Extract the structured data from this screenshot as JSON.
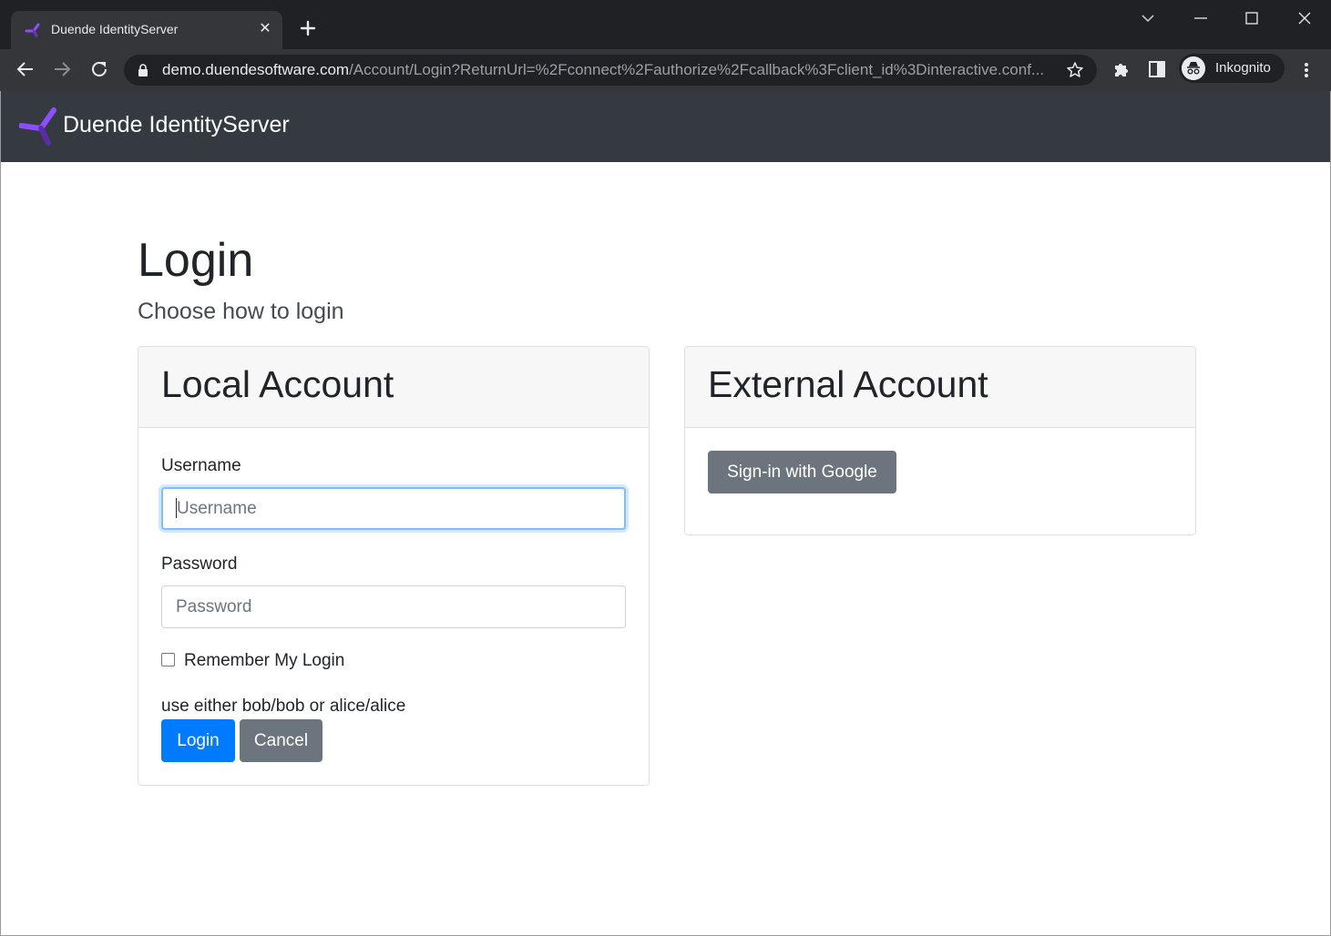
{
  "browser": {
    "tab_title": "Duende IdentityServer",
    "tab_close": "✕",
    "url_host": "demo.duendesoftware.com",
    "url_path": "/Account/Login?ReturnUrl=%2Fconnect%2Fauthorize%2Fcallback%3Fclient_id%3Dinteractive.conf...",
    "profile_label": "Inkognito"
  },
  "navbar": {
    "brand": "Duende IdentityServer"
  },
  "page": {
    "title": "Login",
    "subtitle": "Choose how to login"
  },
  "local_account": {
    "title": "Local Account",
    "username_label": "Username",
    "username_placeholder": "Username",
    "username_value": "",
    "password_label": "Password",
    "password_placeholder": "Password",
    "password_value": "",
    "remember_label": "Remember My Login",
    "remember_checked": false,
    "hint": "use either bob/bob or alice/alice",
    "login_button": "Login",
    "cancel_button": "Cancel"
  },
  "external_account": {
    "title": "External Account",
    "google_button": "Sign-in with Google"
  },
  "colors": {
    "navbar_bg": "#343a40",
    "primary": "#007bff",
    "secondary": "#6c757d",
    "brand_purple": "#7b3fe4"
  }
}
